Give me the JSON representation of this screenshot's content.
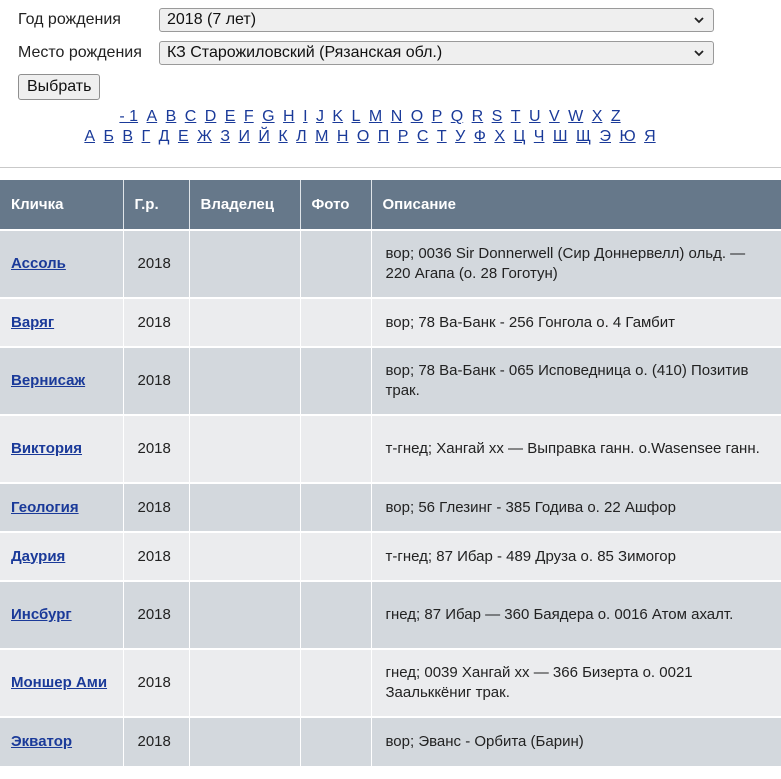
{
  "filters": {
    "year": {
      "label": "Год рождения",
      "value": "2018 (7 лет)"
    },
    "place": {
      "label": "Место рождения",
      "value": "КЗ Старожиловский (Рязанская обл.)"
    },
    "submit_label": "Выбрать"
  },
  "alphabet": {
    "latin": [
      "- 1",
      "A",
      "B",
      "C",
      "D",
      "E",
      "F",
      "G",
      "H",
      "I",
      "J",
      "K",
      "L",
      "M",
      "N",
      "O",
      "P",
      "Q",
      "R",
      "S",
      "T",
      "U",
      "V",
      "W",
      "X",
      "Z"
    ],
    "cyrillic": [
      "А",
      "Б",
      "В",
      "Г",
      "Д",
      "Е",
      "Ж",
      "З",
      "И",
      "Й",
      "К",
      "Л",
      "М",
      "Н",
      "О",
      "П",
      "Р",
      "С",
      "Т",
      "У",
      "Ф",
      "Х",
      "Ц",
      "Ч",
      "Ш",
      "Щ",
      "Э",
      "Ю",
      "Я"
    ]
  },
  "table": {
    "headers": [
      "Кличка",
      "Г.р.",
      "Владелец",
      "Фото",
      "Описание"
    ],
    "rows": [
      {
        "name": "Ассоль",
        "year": "2018",
        "owner": "",
        "photo": "",
        "description": "вор; 0036 Sir Donnerwell (Сир Доннервелл) ольд. — 220 Агапа (о. 28 Гоготун)"
      },
      {
        "name": "Варяг",
        "year": "2018",
        "owner": "",
        "photo": "",
        "description": "вор; 78 Ва-Банк - 256 Гонгола о. 4 Гамбит"
      },
      {
        "name": "Вернисаж",
        "year": "2018",
        "owner": "",
        "photo": "",
        "description": "вор; 78 Ва-Банк - 065 Исповедница о. (410) Позитив трак."
      },
      {
        "name": "Виктория",
        "year": "2018",
        "owner": "",
        "photo": "",
        "description": "т-гнед; Хангай хх — Выправка ганн. о.Wasensee ганн."
      },
      {
        "name": "Геология",
        "year": "2018",
        "owner": "",
        "photo": "",
        "description": "вор; 56 Глезинг - 385 Годива о. 22 Ашфор"
      },
      {
        "name": "Даурия",
        "year": "2018",
        "owner": "",
        "photo": "",
        "description": "т-гнед; 87 Ибар - 489 Друза о. 85 Зимогор"
      },
      {
        "name": "Инсбург",
        "year": "2018",
        "owner": "",
        "photo": "",
        "description": "гнед; 87 Ибар — 360 Баядера о. 0016 Атом ахалт."
      },
      {
        "name": "Моншер Ами",
        "year": "2018",
        "owner": "",
        "photo": "",
        "description": "гнед; 0039 Хангай хх — 366 Бизерта о. 0021 Заальккёниг трак."
      },
      {
        "name": "Экватор",
        "year": "2018",
        "owner": "",
        "photo": "",
        "description": "вор; Эванс - Орбита (Барин)"
      }
    ]
  }
}
